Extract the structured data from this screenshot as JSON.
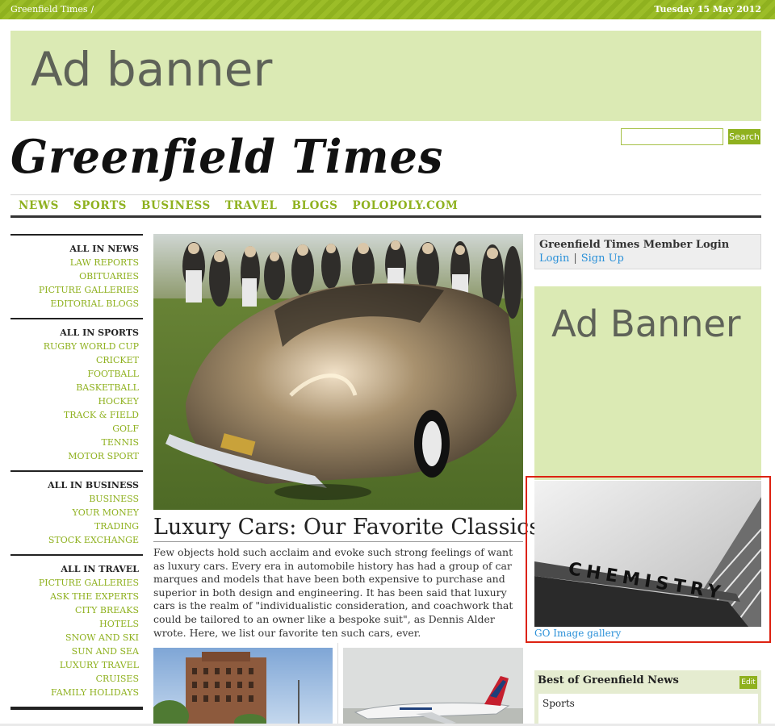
{
  "topbar": {
    "site_name": "Greenfield Times",
    "separator": "/",
    "date": "Tuesday 15 May 2012"
  },
  "ads": {
    "top_label": "Ad banner",
    "right_label": "Ad Banner"
  },
  "logo": {
    "text": "Greenfield Times"
  },
  "search": {
    "value": "",
    "button_label": "Search"
  },
  "nav": {
    "items": [
      "NEWS",
      "SPORTS",
      "BUSINESS",
      "TRAVEL",
      "BLOGS",
      "POLOPOLY.COM"
    ]
  },
  "sidebar": {
    "sections": [
      {
        "heading": "ALL IN NEWS",
        "items": [
          "LAW REPORTS",
          "OBITUARIES",
          "PICTURE GALLERIES",
          "EDITORIAL BLOGS"
        ]
      },
      {
        "heading": "ALL IN SPORTS",
        "items": [
          "RUGBY WORLD CUP",
          "CRICKET",
          "FOOTBALL",
          "BASKETBALL",
          "HOCKEY",
          "TRACK & FIELD",
          "GOLF",
          "TENNIS",
          "MOTOR SPORT"
        ]
      },
      {
        "heading": "ALL IN BUSINESS",
        "items": [
          "BUSINESS",
          "YOUR MONEY",
          "TRADING",
          "STOCK EXCHANGE"
        ]
      },
      {
        "heading": "ALL IN TRAVEL",
        "items": [
          "PICTURE GALLERIES",
          "ASK THE EXPERTS",
          "CITY BREAKS",
          "HOTELS",
          "SNOW AND SKI",
          "SUN AND SEA",
          "LUXURY TRAVEL",
          "CRUISES",
          "FAMILY HOLIDAYS"
        ]
      }
    ]
  },
  "article": {
    "title": "Luxury Cars: Our Favorite Classics",
    "body": "Few objects hold such acclaim and evoke such strong feelings of want as luxury cars. Every era in automobile history has had a group of car marques and models that have been both expensive to purchase and superior in both design and engineering. It has been said that luxury cars is the realm of \"individualistic consideration, and coachwork that could be tailored to an owner like a bespoke suit\", as Dennis Alder wrote. Here, we list our favorite ten such cars, ever."
  },
  "login": {
    "title": "Greenfield Times Member Login",
    "login_label": "Login",
    "separator": "|",
    "signup_label": "Sign Up"
  },
  "gallery": {
    "sign_text": "CHEMISTRY",
    "link_label": "GO Image gallery"
  },
  "best": {
    "title": "Best of Greenfield News",
    "edit_label": "Edit",
    "tab_label": "Sports"
  },
  "colors": {
    "accent": "#8fb11f",
    "ad_background": "#dbeab4",
    "link": "#2a90d8",
    "highlight_border": "#dd2211"
  },
  "icons": {
    "car_photo": "vintage-car-image",
    "hotel_photo": "hotel-building-image",
    "plane_photo": "airplane-image",
    "gallery_photo": "building-sign-image"
  }
}
